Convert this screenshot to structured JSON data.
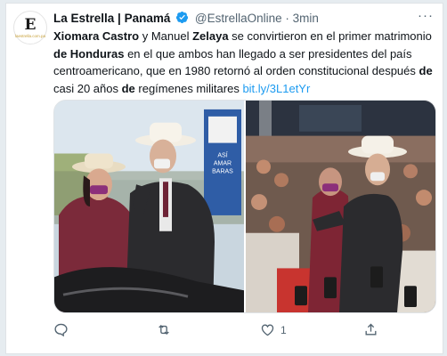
{
  "tweet": {
    "avatar_letter": "E",
    "avatar_subtext": "laestrella.com.pa",
    "author_name": "La Estrella | Panamá",
    "handle": "@EstrellaOnline",
    "separator": "·",
    "time": "3min",
    "text_parts": [
      {
        "t": "Xiomara Castro",
        "b": true
      },
      {
        "t": " y Manuel ",
        "b": false
      },
      {
        "t": "Zelaya",
        "b": true
      },
      {
        "t": " se convirtieron en el primer  matrimonio ",
        "b": false
      },
      {
        "t": "de Honduras",
        "b": true
      },
      {
        "t": " en el que ambos han llegado a ser presidentes del país centroamericano, que en 1980 retornó al orden constitucional después ",
        "b": false
      },
      {
        "t": "de",
        "b": true
      },
      {
        "t": " casi 20 años ",
        "b": false
      },
      {
        "t": "de",
        "b": true
      },
      {
        "t": " regímenes militares ",
        "b": false
      }
    ],
    "link_text": "bit.ly/3L1etYr",
    "like_count": "1",
    "colors": {
      "link": "#1d9bf0",
      "verified": "#1d9bf0",
      "muted": "#536471"
    }
  },
  "media": {
    "sign_text_1": "ASÍ",
    "sign_text_2": "AMAR",
    "sign_text_3": "BARAS"
  },
  "icons": [
    "verified-badge-icon",
    "more-icon",
    "reply-icon",
    "retweet-icon",
    "like-icon",
    "share-icon"
  ]
}
